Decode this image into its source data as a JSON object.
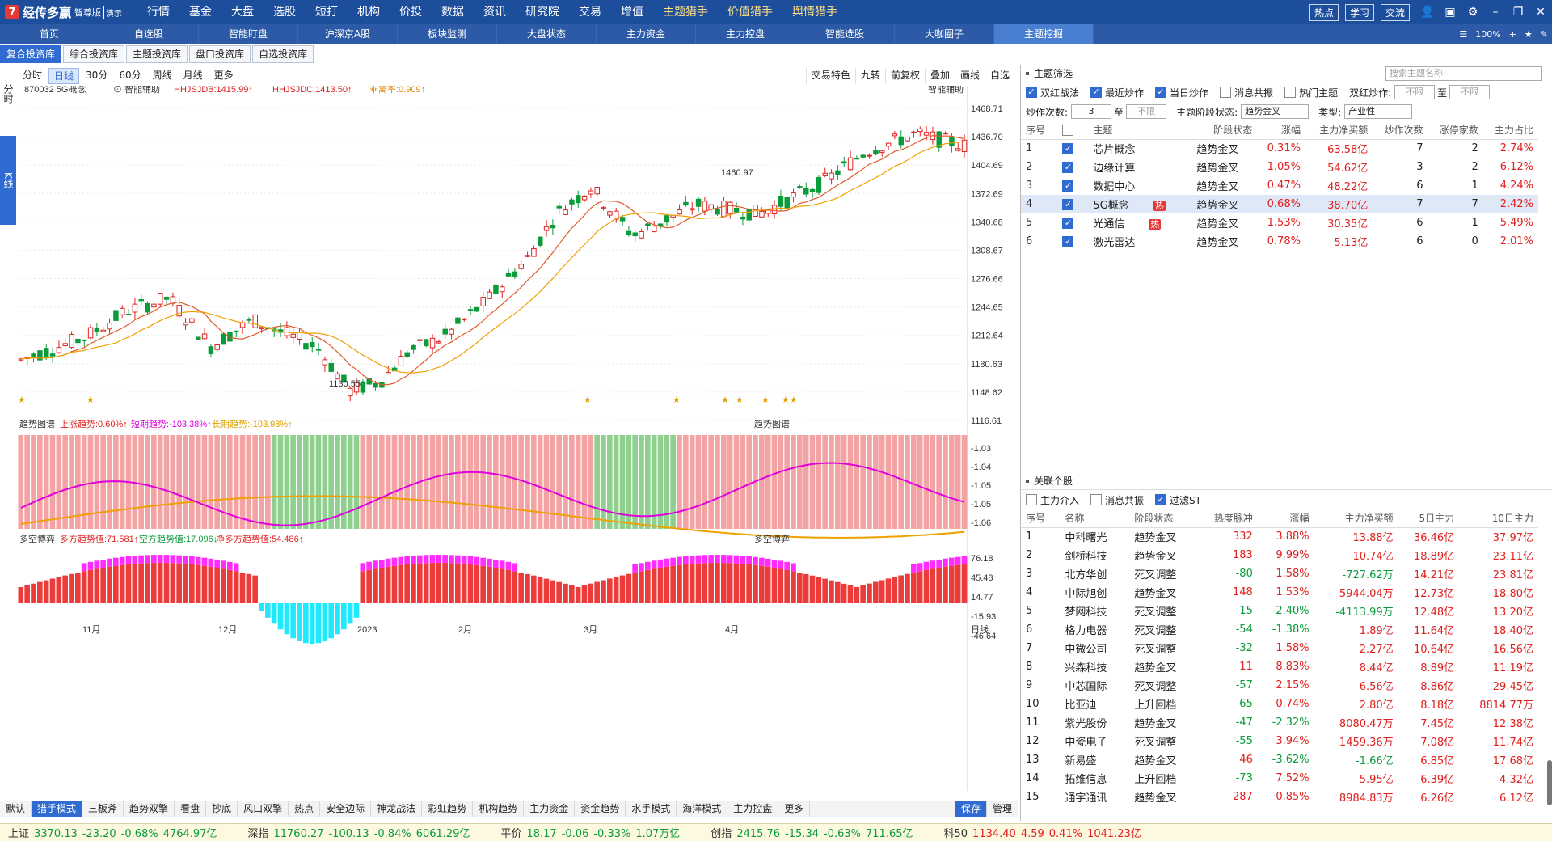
{
  "app": {
    "logo_mark": "7",
    "name": "经传多赢",
    "edition": "智尊版",
    "demo_tag": "演示",
    "menu": [
      "行情",
      "基金",
      "大盘",
      "选股",
      "短打",
      "机构",
      "价投",
      "数据",
      "资讯",
      "研究院",
      "交易",
      "增值"
    ],
    "hunters": [
      "主题猎手",
      "价值猎手",
      "舆情猎手"
    ],
    "top_right_pills": [
      "热点",
      "学习",
      "交流"
    ]
  },
  "navbar": {
    "items": [
      "首页",
      "自选股",
      "智能盯盘",
      "沪深京A股",
      "板块监测",
      "大盘状态",
      "主力资金",
      "主力控盘",
      "智能选股",
      "大咖圈子",
      "主题挖掘"
    ],
    "active_index": 10,
    "zoom": "100%"
  },
  "subtabs": {
    "items": [
      "复合投资库",
      "综合投资库",
      "主题投资库",
      "盘口投资库",
      "自选投资库"
    ],
    "active_index": 0
  },
  "side_tabs": [
    "分时",
    "K线"
  ],
  "period_bar": {
    "items": [
      "分时",
      "日线",
      "30分",
      "60分",
      "周线",
      "月线",
      "更多"
    ],
    "active_index": 1
  },
  "chart_tools": [
    "交易特色",
    "九转",
    "前复权",
    "叠加",
    "画线",
    "自选"
  ],
  "kline_header": {
    "code_name": "870032 5G概念",
    "assist": "智能辅助",
    "hhjsjdb": "HHJSJDB:1415.99",
    "hhjsjdc": "HHJSJDC:1413.50",
    "gap_rate": "乖离率:0.909",
    "right_label": "智能辅助"
  },
  "trend_header": {
    "name": "趋势图谱",
    "up": "上涨趋势:0.60%",
    "short": "短期趋势:-103.38%",
    "long": "长期趋势:-103.98%",
    "right_label": "趋势图谱"
  },
  "duokong_header": {
    "name": "多空博弈",
    "long_val": "多方趋势值:71.581",
    "short_val": "空方趋势值:17.096",
    "net_val": "净多方趋势值:54.486",
    "right_label": "多空博弈"
  },
  "kline_axis": [
    "1468.71",
    "1436.70",
    "1404.69",
    "1372.69",
    "1340.68",
    "1308.67",
    "1276.66",
    "1244.65",
    "1212.64",
    "1180.63",
    "1148.62",
    "1116.61"
  ],
  "trend_axis": [
    "-1.03",
    "-1.04",
    "-1.05",
    "-1.05",
    "-1.06"
  ],
  "duokong_axis": [
    "76.18",
    "45.48",
    "14.77",
    "-15.93",
    "-46.64"
  ],
  "month_labels": [
    "11月",
    "12月",
    "2023",
    "2月",
    "3月",
    "4月"
  ],
  "x_axis_period": "日线",
  "price_annotations": {
    "high": "1460.97",
    "low": "1130.55"
  },
  "bottom_tabs": {
    "items": [
      "默认",
      "猎手模式",
      "三板斧",
      "趋势双擎",
      "看盘",
      "抄底",
      "风口双擎",
      "热点",
      "安全边际",
      "神龙战法",
      "彩虹趋势",
      "机构趋势",
      "主力资金",
      "资金趋势",
      "水手模式",
      "海洋模式",
      "主力控盘",
      "更多"
    ],
    "active_index": 1,
    "right": [
      "保存",
      "管理"
    ]
  },
  "status_bar": [
    {
      "name": "上证",
      "price": "3370.13",
      "chg": "-23.20",
      "pct": "-0.68%",
      "amt": "4764.97亿"
    },
    {
      "name": "深指",
      "price": "11760.27",
      "chg": "-100.13",
      "pct": "-0.84%",
      "amt": "6061.29亿"
    },
    {
      "name": "平价",
      "price": "18.17",
      "chg": "-0.06",
      "pct": "-0.33%",
      "amt": "1.07万亿"
    },
    {
      "name": "创指",
      "price": "2415.76",
      "chg": "-15.34",
      "pct": "-0.63%",
      "amt": "711.65亿"
    },
    {
      "name": "科50",
      "price": "1134.40",
      "chg": "4.59",
      "pct": "0.41%",
      "amt": "1041.23亿"
    }
  ],
  "theme_filter": {
    "title": "主题筛选",
    "search_placeholder": "搜索主题名称",
    "checks": [
      {
        "label": "双红战法",
        "on": true
      },
      {
        "label": "最近炒作",
        "on": true
      },
      {
        "label": "当日炒作",
        "on": true
      },
      {
        "label": "消息共振",
        "on": false
      },
      {
        "label": "热门主题",
        "on": false
      }
    ],
    "shuanghong_label": "双红炒作:",
    "unlimited": "不限",
    "to": "至",
    "count_label": "炒作次数:",
    "count_from": "3",
    "stage_label": "主题阶段状态:",
    "stage_value": "趋势金叉",
    "type_label": "类型:",
    "type_value": "产业性",
    "columns": [
      "序号",
      "",
      "主题",
      "阶段状态",
      "涨幅",
      "主力净买额",
      "炒作次数",
      "涨停家数",
      "主力占比"
    ],
    "rows": [
      {
        "no": "1",
        "name": "芯片概念",
        "hot": "",
        "stage": "趋势金叉",
        "pct": "0.31%",
        "net": "63.58亿",
        "times": "7",
        "limit": "2",
        "ratio": "2.74%"
      },
      {
        "no": "2",
        "name": "边缘计算",
        "hot": "",
        "stage": "趋势金叉",
        "pct": "1.05%",
        "net": "54.62亿",
        "times": "3",
        "limit": "2",
        "ratio": "6.12%"
      },
      {
        "no": "3",
        "name": "数据中心",
        "hot": "",
        "stage": "趋势金叉",
        "pct": "0.47%",
        "net": "48.22亿",
        "times": "6",
        "limit": "1",
        "ratio": "4.24%"
      },
      {
        "no": "4",
        "name": "5G概念",
        "hot": "热",
        "stage": "趋势金叉",
        "pct": "0.68%",
        "net": "38.70亿",
        "times": "7",
        "limit": "7",
        "ratio": "2.42%"
      },
      {
        "no": "5",
        "name": "光通信",
        "hot": "热",
        "stage": "趋势金叉",
        "pct": "1.53%",
        "net": "30.35亿",
        "times": "6",
        "limit": "1",
        "ratio": "5.49%"
      },
      {
        "no": "6",
        "name": "激光雷达",
        "hot": "",
        "stage": "趋势金叉",
        "pct": "0.78%",
        "net": "5.13亿",
        "times": "6",
        "limit": "0",
        "ratio": "2.01%"
      }
    ],
    "selected_index": 3
  },
  "related": {
    "title": "关联个股",
    "checks": [
      {
        "label": "主力介入",
        "on": false
      },
      {
        "label": "消息共振",
        "on": false
      },
      {
        "label": "过滤ST",
        "on": true
      }
    ],
    "columns": [
      "序号",
      "名称",
      "阶段状态",
      "热度脉冲",
      "涨幅",
      "主力净买额",
      "5日主力",
      "10日主力"
    ],
    "rows": [
      {
        "no": "1",
        "name": "中科曙光",
        "stage": "趋势金叉",
        "heat": "332",
        "pct": "3.88%",
        "net": "13.88亿",
        "d5": "36.46亿",
        "d10": "37.97亿"
      },
      {
        "no": "2",
        "name": "剑桥科技",
        "stage": "趋势金叉",
        "heat": "183",
        "pct": "9.99%",
        "net": "10.74亿",
        "d5": "18.89亿",
        "d10": "23.11亿"
      },
      {
        "no": "3",
        "name": "北方华创",
        "stage": "死叉调整",
        "heat": "-80",
        "pct": "1.58%",
        "net": "-727.62万",
        "d5": "14.21亿",
        "d10": "23.81亿"
      },
      {
        "no": "4",
        "name": "中际旭创",
        "stage": "趋势金叉",
        "heat": "148",
        "pct": "1.53%",
        "net": "5944.04万",
        "d5": "12.73亿",
        "d10": "18.80亿"
      },
      {
        "no": "5",
        "name": "梦网科技",
        "stage": "死叉调整",
        "heat": "-15",
        "pct": "-2.40%",
        "net": "-4113.99万",
        "d5": "12.48亿",
        "d10": "13.20亿"
      },
      {
        "no": "6",
        "name": "格力电器",
        "stage": "死叉调整",
        "heat": "-54",
        "pct": "-1.38%",
        "net": "1.89亿",
        "d5": "11.64亿",
        "d10": "18.40亿"
      },
      {
        "no": "7",
        "name": "中微公司",
        "stage": "死叉调整",
        "heat": "-32",
        "pct": "1.58%",
        "net": "2.27亿",
        "d5": "10.64亿",
        "d10": "16.56亿"
      },
      {
        "no": "8",
        "name": "兴森科技",
        "stage": "趋势金叉",
        "heat": "11",
        "pct": "8.83%",
        "net": "8.44亿",
        "d5": "8.89亿",
        "d10": "11.19亿"
      },
      {
        "no": "9",
        "name": "中芯国际",
        "stage": "死叉调整",
        "heat": "-57",
        "pct": "2.15%",
        "net": "6.56亿",
        "d5": "8.86亿",
        "d10": "29.45亿"
      },
      {
        "no": "10",
        "name": "比亚迪",
        "stage": "上升回档",
        "heat": "-65",
        "pct": "0.74%",
        "net": "2.80亿",
        "d5": "8.18亿",
        "d10": "8814.77万"
      },
      {
        "no": "11",
        "name": "紫光股份",
        "stage": "趋势金叉",
        "heat": "-47",
        "pct": "-2.32%",
        "net": "8080.47万",
        "d5": "7.45亿",
        "d10": "12.38亿"
      },
      {
        "no": "12",
        "name": "中瓷电子",
        "stage": "死叉调整",
        "heat": "-55",
        "pct": "3.94%",
        "net": "1459.36万",
        "d5": "7.08亿",
        "d10": "11.74亿"
      },
      {
        "no": "13",
        "name": "新易盛",
        "stage": "趋势金叉",
        "heat": "46",
        "pct": "-3.62%",
        "net": "-1.66亿",
        "d5": "6.85亿",
        "d10": "17.68亿"
      },
      {
        "no": "14",
        "name": "拓维信息",
        "stage": "上升回档",
        "heat": "-73",
        "pct": "7.52%",
        "net": "5.95亿",
        "d5": "6.39亿",
        "d10": "4.32亿"
      },
      {
        "no": "15",
        "name": "通宇通讯",
        "stage": "趋势金叉",
        "heat": "287",
        "pct": "0.85%",
        "net": "8984.83万",
        "d5": "6.26亿",
        "d10": "6.12亿"
      }
    ]
  },
  "colors": {
    "up": "#e0201e",
    "down": "#0a9b3a",
    "accent": "#2f6bd0",
    "magenta": "#ff00ff",
    "orange": "#f0a000",
    "cyan": "#00e5ff"
  }
}
